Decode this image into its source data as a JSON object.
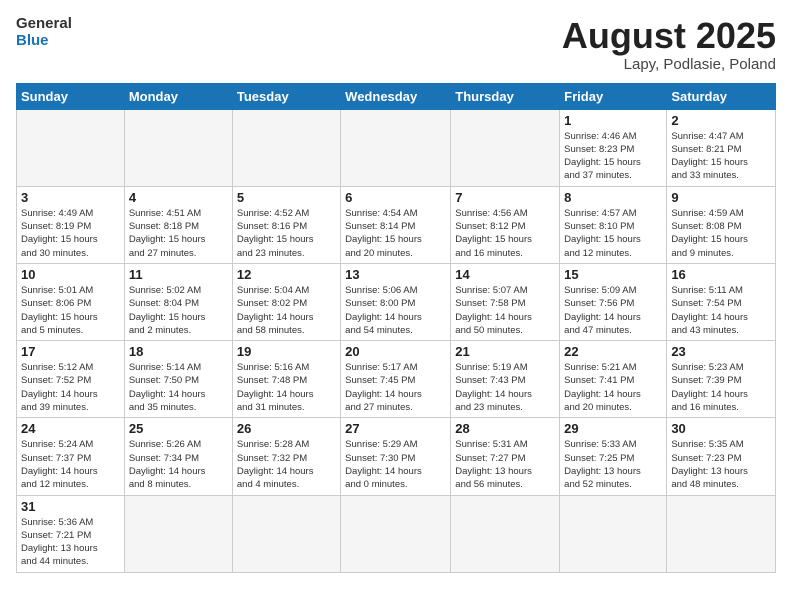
{
  "header": {
    "logo_general": "General",
    "logo_blue": "Blue",
    "month_title": "August 2025",
    "subtitle": "Lapy, Podlasie, Poland"
  },
  "weekdays": [
    "Sunday",
    "Monday",
    "Tuesday",
    "Wednesday",
    "Thursday",
    "Friday",
    "Saturday"
  ],
  "weeks": [
    [
      {
        "day": "",
        "info": ""
      },
      {
        "day": "",
        "info": ""
      },
      {
        "day": "",
        "info": ""
      },
      {
        "day": "",
        "info": ""
      },
      {
        "day": "",
        "info": ""
      },
      {
        "day": "1",
        "info": "Sunrise: 4:46 AM\nSunset: 8:23 PM\nDaylight: 15 hours\nand 37 minutes."
      },
      {
        "day": "2",
        "info": "Sunrise: 4:47 AM\nSunset: 8:21 PM\nDaylight: 15 hours\nand 33 minutes."
      }
    ],
    [
      {
        "day": "3",
        "info": "Sunrise: 4:49 AM\nSunset: 8:19 PM\nDaylight: 15 hours\nand 30 minutes."
      },
      {
        "day": "4",
        "info": "Sunrise: 4:51 AM\nSunset: 8:18 PM\nDaylight: 15 hours\nand 27 minutes."
      },
      {
        "day": "5",
        "info": "Sunrise: 4:52 AM\nSunset: 8:16 PM\nDaylight: 15 hours\nand 23 minutes."
      },
      {
        "day": "6",
        "info": "Sunrise: 4:54 AM\nSunset: 8:14 PM\nDaylight: 15 hours\nand 20 minutes."
      },
      {
        "day": "7",
        "info": "Sunrise: 4:56 AM\nSunset: 8:12 PM\nDaylight: 15 hours\nand 16 minutes."
      },
      {
        "day": "8",
        "info": "Sunrise: 4:57 AM\nSunset: 8:10 PM\nDaylight: 15 hours\nand 12 minutes."
      },
      {
        "day": "9",
        "info": "Sunrise: 4:59 AM\nSunset: 8:08 PM\nDaylight: 15 hours\nand 9 minutes."
      }
    ],
    [
      {
        "day": "10",
        "info": "Sunrise: 5:01 AM\nSunset: 8:06 PM\nDaylight: 15 hours\nand 5 minutes."
      },
      {
        "day": "11",
        "info": "Sunrise: 5:02 AM\nSunset: 8:04 PM\nDaylight: 15 hours\nand 2 minutes."
      },
      {
        "day": "12",
        "info": "Sunrise: 5:04 AM\nSunset: 8:02 PM\nDaylight: 14 hours\nand 58 minutes."
      },
      {
        "day": "13",
        "info": "Sunrise: 5:06 AM\nSunset: 8:00 PM\nDaylight: 14 hours\nand 54 minutes."
      },
      {
        "day": "14",
        "info": "Sunrise: 5:07 AM\nSunset: 7:58 PM\nDaylight: 14 hours\nand 50 minutes."
      },
      {
        "day": "15",
        "info": "Sunrise: 5:09 AM\nSunset: 7:56 PM\nDaylight: 14 hours\nand 47 minutes."
      },
      {
        "day": "16",
        "info": "Sunrise: 5:11 AM\nSunset: 7:54 PM\nDaylight: 14 hours\nand 43 minutes."
      }
    ],
    [
      {
        "day": "17",
        "info": "Sunrise: 5:12 AM\nSunset: 7:52 PM\nDaylight: 14 hours\nand 39 minutes."
      },
      {
        "day": "18",
        "info": "Sunrise: 5:14 AM\nSunset: 7:50 PM\nDaylight: 14 hours\nand 35 minutes."
      },
      {
        "day": "19",
        "info": "Sunrise: 5:16 AM\nSunset: 7:48 PM\nDaylight: 14 hours\nand 31 minutes."
      },
      {
        "day": "20",
        "info": "Sunrise: 5:17 AM\nSunset: 7:45 PM\nDaylight: 14 hours\nand 27 minutes."
      },
      {
        "day": "21",
        "info": "Sunrise: 5:19 AM\nSunset: 7:43 PM\nDaylight: 14 hours\nand 23 minutes."
      },
      {
        "day": "22",
        "info": "Sunrise: 5:21 AM\nSunset: 7:41 PM\nDaylight: 14 hours\nand 20 minutes."
      },
      {
        "day": "23",
        "info": "Sunrise: 5:23 AM\nSunset: 7:39 PM\nDaylight: 14 hours\nand 16 minutes."
      }
    ],
    [
      {
        "day": "24",
        "info": "Sunrise: 5:24 AM\nSunset: 7:37 PM\nDaylight: 14 hours\nand 12 minutes."
      },
      {
        "day": "25",
        "info": "Sunrise: 5:26 AM\nSunset: 7:34 PM\nDaylight: 14 hours\nand 8 minutes."
      },
      {
        "day": "26",
        "info": "Sunrise: 5:28 AM\nSunset: 7:32 PM\nDaylight: 14 hours\nand 4 minutes."
      },
      {
        "day": "27",
        "info": "Sunrise: 5:29 AM\nSunset: 7:30 PM\nDaylight: 14 hours\nand 0 minutes."
      },
      {
        "day": "28",
        "info": "Sunrise: 5:31 AM\nSunset: 7:27 PM\nDaylight: 13 hours\nand 56 minutes."
      },
      {
        "day": "29",
        "info": "Sunrise: 5:33 AM\nSunset: 7:25 PM\nDaylight: 13 hours\nand 52 minutes."
      },
      {
        "day": "30",
        "info": "Sunrise: 5:35 AM\nSunset: 7:23 PM\nDaylight: 13 hours\nand 48 minutes."
      }
    ],
    [
      {
        "day": "31",
        "info": "Sunrise: 5:36 AM\nSunset: 7:21 PM\nDaylight: 13 hours\nand 44 minutes."
      },
      {
        "day": "",
        "info": ""
      },
      {
        "day": "",
        "info": ""
      },
      {
        "day": "",
        "info": ""
      },
      {
        "day": "",
        "info": ""
      },
      {
        "day": "",
        "info": ""
      },
      {
        "day": "",
        "info": ""
      }
    ]
  ]
}
